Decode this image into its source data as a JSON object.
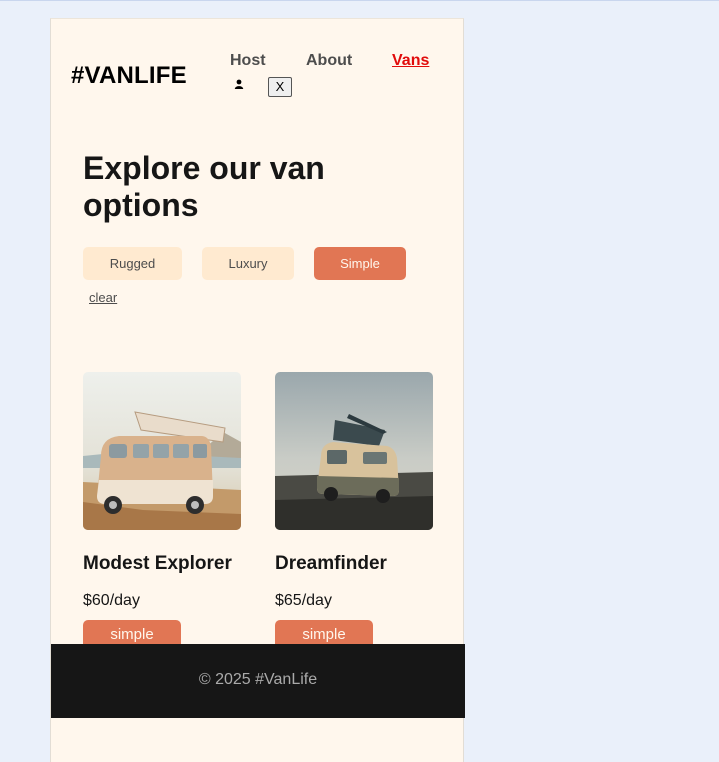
{
  "header": {
    "logo": "#VANLIFE",
    "nav": {
      "host": "Host",
      "about": "About",
      "vans": "Vans"
    },
    "close_label": "X",
    "user_icon": "user-icon"
  },
  "main": {
    "title": "Explore our van options",
    "filters": [
      {
        "label": "Rugged",
        "selected": false
      },
      {
        "label": "Luxury",
        "selected": false
      },
      {
        "label": "Simple",
        "selected": true
      }
    ],
    "clear_label": "clear",
    "vans": [
      {
        "name": "Modest Explorer",
        "price": "$60/day",
        "type": "simple"
      },
      {
        "name": "Dreamfinder",
        "price": "$65/day",
        "type": "simple"
      }
    ]
  },
  "footer": {
    "text": "© 2025 #VanLife"
  },
  "colors": {
    "page_bg": "#eaf0fa",
    "app_bg": "#fff7ed",
    "accent": "#e17654",
    "filter_bg": "#ffead0",
    "active_nav": "#e10b0b",
    "footer_bg": "#161616"
  }
}
